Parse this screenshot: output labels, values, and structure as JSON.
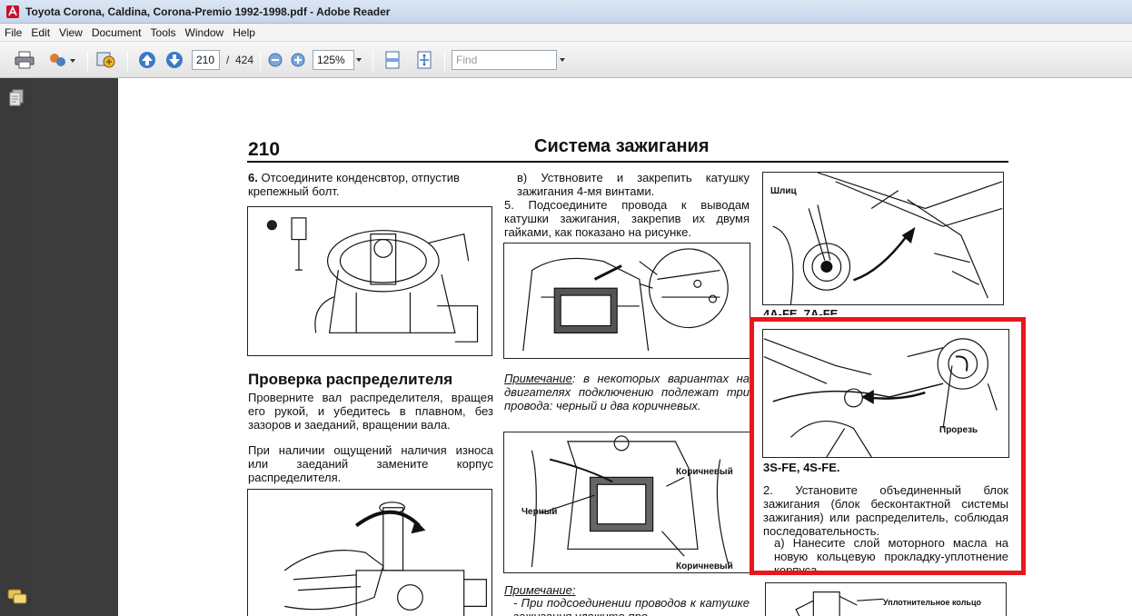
{
  "window": {
    "title": "Toyota Corona, Caldina, Corona-Premio 1992-1998.pdf - Adobe Reader"
  },
  "menu": [
    "File",
    "Edit",
    "View",
    "Document",
    "Tools",
    "Window",
    "Help"
  ],
  "toolbar": {
    "page_current": "210",
    "page_sep": "/",
    "page_total": "424",
    "zoom": "125%",
    "find_placeholder": "Find"
  },
  "document": {
    "page_number": "210",
    "page_title": "Система зажигания",
    "col1": {
      "step6_num": "6.",
      "step6_text": " Отсоедините конденсвтор, отпустив крепежный болт.",
      "section_heading": "Проверка распределителя",
      "para1": "Проверните вал распределителя, вращея его рукой, и убедитесь в плавном, без зазоров и заеданий, вращении вала.",
      "para2": "При наличии ощущений наличия износа или заеданий замените корпус распределителя."
    },
    "col2": {
      "step_v": "в) Уствновите и закрепить катушку зажигания 4-мя винтами.",
      "step5": "5. Подсоедините провода к выводам катушки зажигания, закрепив их двумя гайками, как показано на рисунке.",
      "note1_label": "Примечание",
      "note1_text": ": в некоторых вариантах на двигателях подключению подлежат три провода: черный и два коричневых.",
      "fig_label_brown_top": "Коричневый",
      "fig_label_black": "Черный",
      "fig_label_brown_bottom": "Коричневый",
      "note2_label": "Примечание:",
      "note2_text": "- При подсоединении проводов к катушке зажигания уложите про-"
    },
    "col3": {
      "fig1_label": "Шлиц",
      "engine1_label": "4A-FE, 7A-FE",
      "fig2_label": "Прорезь",
      "engine2_label": "3S-FE, 4S-FE.",
      "step2": "2. Установите объединенный блок зажигания (блок бесконтактной системы зажигания) или распределитель, соблюдая последовательность.",
      "step2a": "а) Нанесите слой моторного масла на новую кольцевую прокладку-уплотнение корпуса.",
      "fig3_label": "Уплотнительное кольцо"
    }
  },
  "colors": {
    "highlight": "#e8161d",
    "sidebar": "#3a3a3a",
    "page": "#ffffff"
  }
}
